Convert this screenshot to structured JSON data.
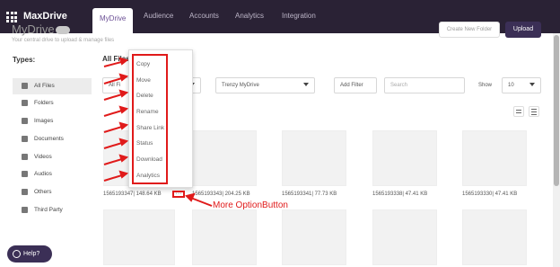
{
  "brand": "MaxDrive",
  "nav_tabs": [
    {
      "label": "MyDrive",
      "active": true
    },
    {
      "label": "Audience"
    },
    {
      "label": "Accounts"
    },
    {
      "label": "Analytics"
    },
    {
      "label": "Integration"
    }
  ],
  "page": {
    "title": "MyDrive",
    "subtitle": "Your central drive to upload & manage files",
    "create_folder": "Create New Folder",
    "upload": "Upload"
  },
  "sidebar": {
    "title": "Types:",
    "items": [
      {
        "label": "All Files",
        "icon": "grid-icon",
        "active": true
      },
      {
        "label": "Folders",
        "icon": "folder-icon"
      },
      {
        "label": "Images",
        "icon": "image-icon"
      },
      {
        "label": "Documents",
        "icon": "document-icon"
      },
      {
        "label": "Videos",
        "icon": "video-icon"
      },
      {
        "label": "Audios",
        "icon": "audio-icon"
      },
      {
        "label": "Others",
        "icon": "others-icon"
      },
      {
        "label": "Third Party",
        "icon": "third-party-icon"
      }
    ]
  },
  "main": {
    "section_title": "All Files",
    "filter_type_value": "All Fi",
    "drive_select_value": "Trenzy MyDrive",
    "add_filter": "Add Filter",
    "search_placeholder": "Search",
    "show_label": "Show",
    "show_value": "10"
  },
  "context_menu": {
    "items": [
      "Copy",
      "Move",
      "Delete",
      "Rename",
      "Share Link",
      "Status",
      "Download",
      "Analytics"
    ]
  },
  "files": [
    {
      "label": "1565193347| 148.64 KB"
    },
    {
      "label": "1565193343| 204.25 KB"
    },
    {
      "label": "1565193341| 77.73 KB"
    },
    {
      "label": "1565193338| 47.41 KB"
    },
    {
      "label": "1565193330| 47.41 KB"
    }
  ],
  "more_button": "···",
  "annotation": "More OptionButton",
  "help": "Help?",
  "colors": {
    "topbar": "#2a2235",
    "accent": "#3b2f56",
    "annotation": "#e01a1a"
  }
}
